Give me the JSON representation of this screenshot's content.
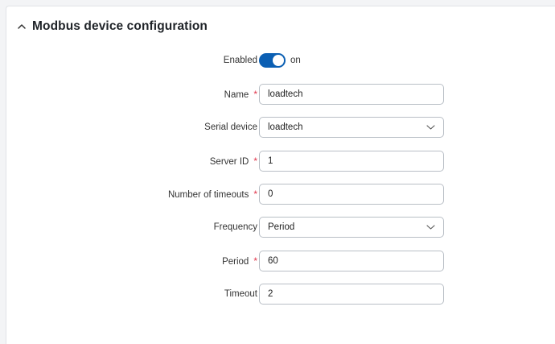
{
  "section": {
    "title": "Modbus device configuration",
    "collapse_icon": "chevron-up-icon"
  },
  "fields": {
    "enabled": {
      "label": "Enabled",
      "state": "on"
    },
    "name": {
      "label": "Name",
      "required_mark": "*",
      "value": "loadtech"
    },
    "serial_device": {
      "label": "Serial device",
      "value": "loadtech",
      "icon": "chevron-down-icon"
    },
    "server_id": {
      "label": "Server ID",
      "required_mark": "*",
      "value": "1"
    },
    "number_of_timeouts": {
      "label": "Number of timeouts",
      "required_mark": "*",
      "value": "0"
    },
    "frequency": {
      "label": "Frequency",
      "value": "Period",
      "icon": "chevron-down-icon"
    },
    "period": {
      "label": "Period",
      "required_mark": "*",
      "value": "60"
    },
    "timeout": {
      "label": "Timeout",
      "value": "2"
    }
  },
  "colors": {
    "toggle_on": "#0b5fb3",
    "required": "#e0344b",
    "border": "#b9bfc6"
  }
}
